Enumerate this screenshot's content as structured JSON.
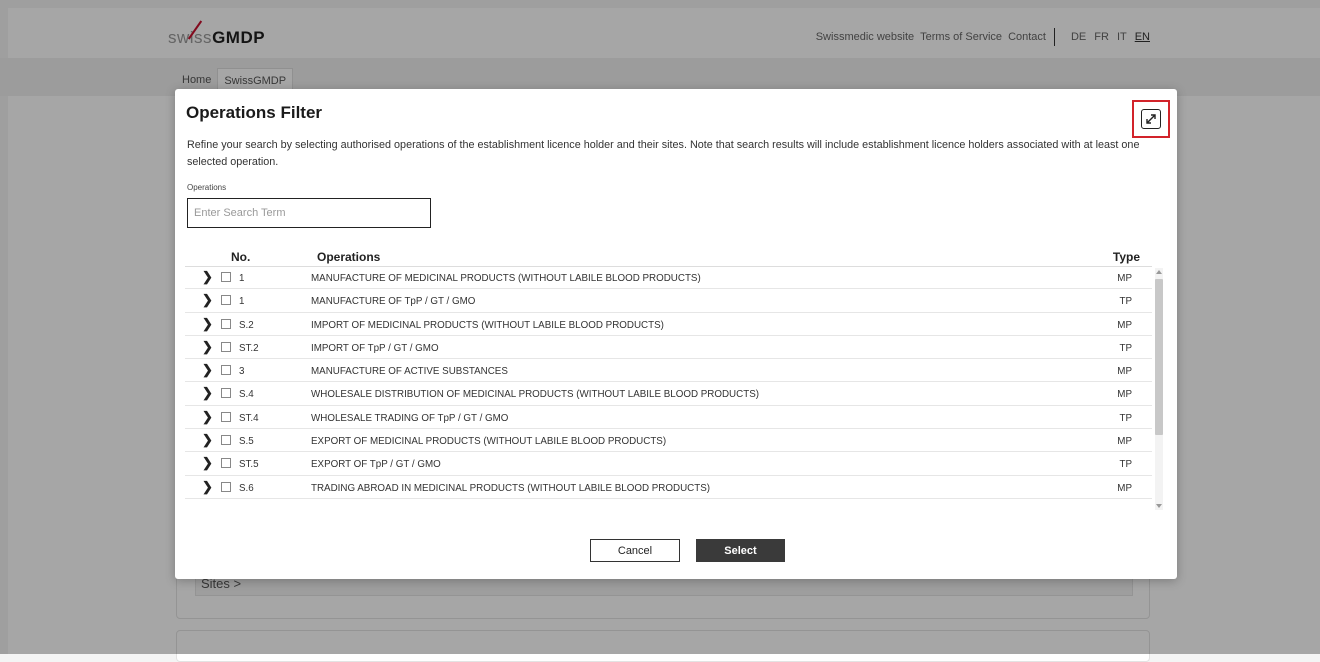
{
  "header": {
    "logo_swiss": "swiss",
    "logo_gmdp": "GMDP",
    "links": [
      "Swissmedic website",
      "Terms of Service",
      "Contact"
    ],
    "languages": [
      "DE",
      "FR",
      "IT",
      "EN"
    ],
    "active_language": "EN",
    "accent_color": "#c8102e"
  },
  "tabs": [
    "Home",
    "SwissGMDP"
  ],
  "background": {
    "sites_label": "Sites",
    "sites_chevron": ">"
  },
  "modal": {
    "title": "Operations Filter",
    "expand_icon": "expand-icon",
    "description": "Refine your search by selecting authorised operations of the establishment licence holder and their sites. Note that search results will include establishment licence holders associated with at least one selected operation.",
    "field_label": "Operations",
    "search_placeholder": "Enter Search Term",
    "columns": {
      "no": "No.",
      "operations": "Operations",
      "type": "Type"
    },
    "rows": [
      {
        "no": "1",
        "operation": "MANUFACTURE OF MEDICINAL PRODUCTS (WITHOUT LABILE BLOOD PRODUCTS)",
        "type": "MP"
      },
      {
        "no": "1",
        "operation": "MANUFACTURE OF TpP / GT / GMO",
        "type": "TP"
      },
      {
        "no": "S.2",
        "operation": "IMPORT OF MEDICINAL PRODUCTS (WITHOUT LABILE BLOOD PRODUCTS)",
        "type": "MP"
      },
      {
        "no": "ST.2",
        "operation": "IMPORT OF TpP / GT / GMO",
        "type": "TP"
      },
      {
        "no": "3",
        "operation": "MANUFACTURE OF ACTIVE SUBSTANCES",
        "type": "MP"
      },
      {
        "no": "S.4",
        "operation": "WHOLESALE DISTRIBUTION OF MEDICINAL PRODUCTS (WITHOUT LABILE BLOOD PRODUCTS)",
        "type": "MP"
      },
      {
        "no": "ST.4",
        "operation": "WHOLESALE TRADING OF TpP / GT / GMO",
        "type": "TP"
      },
      {
        "no": "S.5",
        "operation": "EXPORT OF MEDICINAL PRODUCTS (WITHOUT LABILE BLOOD PRODUCTS)",
        "type": "MP"
      },
      {
        "no": "ST.5",
        "operation": "EXPORT OF TpP / GT / GMO",
        "type": "TP"
      },
      {
        "no": "S.6",
        "operation": "TRADING ABROAD IN MEDICINAL PRODUCTS (WITHOUT LABILE BLOOD PRODUCTS)",
        "type": "MP"
      }
    ],
    "cancel_label": "Cancel",
    "select_label": "Select"
  }
}
